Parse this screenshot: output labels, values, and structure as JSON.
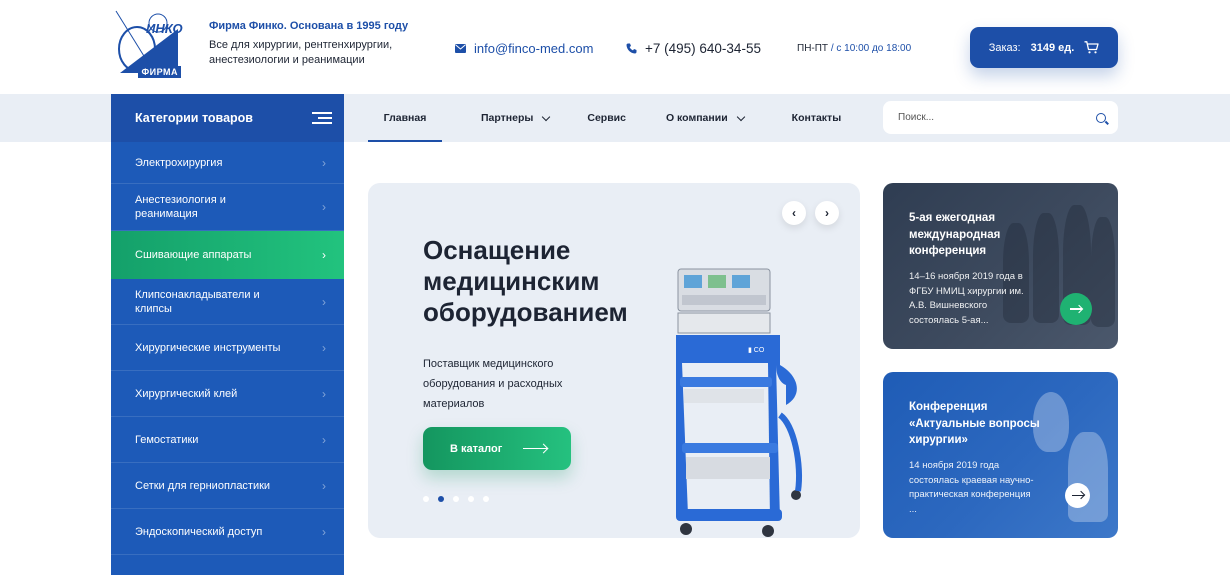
{
  "header": {
    "logo_text": "ИНКО",
    "logo_brand": "ФИРМА",
    "company_line": "Фирма Финко. Основана в 1995 году",
    "tagline": "Все для хирургии, рентгенхирургии, анестезиологии и реанимации",
    "email": "info@finco-med.com",
    "phone": "+7 (495) 640-34-55",
    "hours_days": "ПН-ПТ",
    "hours_sep": " / ",
    "hours_time": "с 10:00 до 18:00",
    "order_label": "Заказ:",
    "order_count": "3149 ед."
  },
  "nav": {
    "items": [
      {
        "label": "Главная",
        "dropdown": false
      },
      {
        "label": "Партнеры",
        "dropdown": true
      },
      {
        "label": "Сервис",
        "dropdown": false
      },
      {
        "label": "О компании",
        "dropdown": true
      },
      {
        "label": "Контакты",
        "dropdown": false
      }
    ],
    "search_placeholder": "Поиск..."
  },
  "sidebar": {
    "title": "Категории товаров",
    "items": [
      {
        "label": "Электрохирургия"
      },
      {
        "label": "Анестезиология и реанимация"
      },
      {
        "label": "Сшивающие аппараты"
      },
      {
        "label": "Клипсонакладыватели и клипсы"
      },
      {
        "label": "Хирургические инструменты"
      },
      {
        "label": "Хирургический клей"
      },
      {
        "label": "Гемостатики"
      },
      {
        "label": "Сетки для герниопластики"
      },
      {
        "label": "Эндоскопический доступ"
      }
    ]
  },
  "hero": {
    "title": "Оснащение медицинским оборудованием",
    "subtitle": "Поставщик медицинского оборудования и расходных материалов",
    "button_label": "В каталог",
    "prev_icon": "‹",
    "next_icon": "›",
    "slides": 5,
    "active_slide": 2
  },
  "news": [
    {
      "title": "5-ая ежегодная международная конференция",
      "text": "14–16 ноября 2019 года в ФГБУ НМИЦ хирургии им. А.В. Вишневского состоялась 5-ая..."
    },
    {
      "title": "Конференция «Актуальные вопросы хирургии»",
      "text": "14 ноября 2019 года состоялась краевая научно-практическая конференция ..."
    }
  ],
  "colors": {
    "brand_blue": "#1d4fa8",
    "accent_green": "#22c37e",
    "nav_bg": "#e9eef5"
  }
}
